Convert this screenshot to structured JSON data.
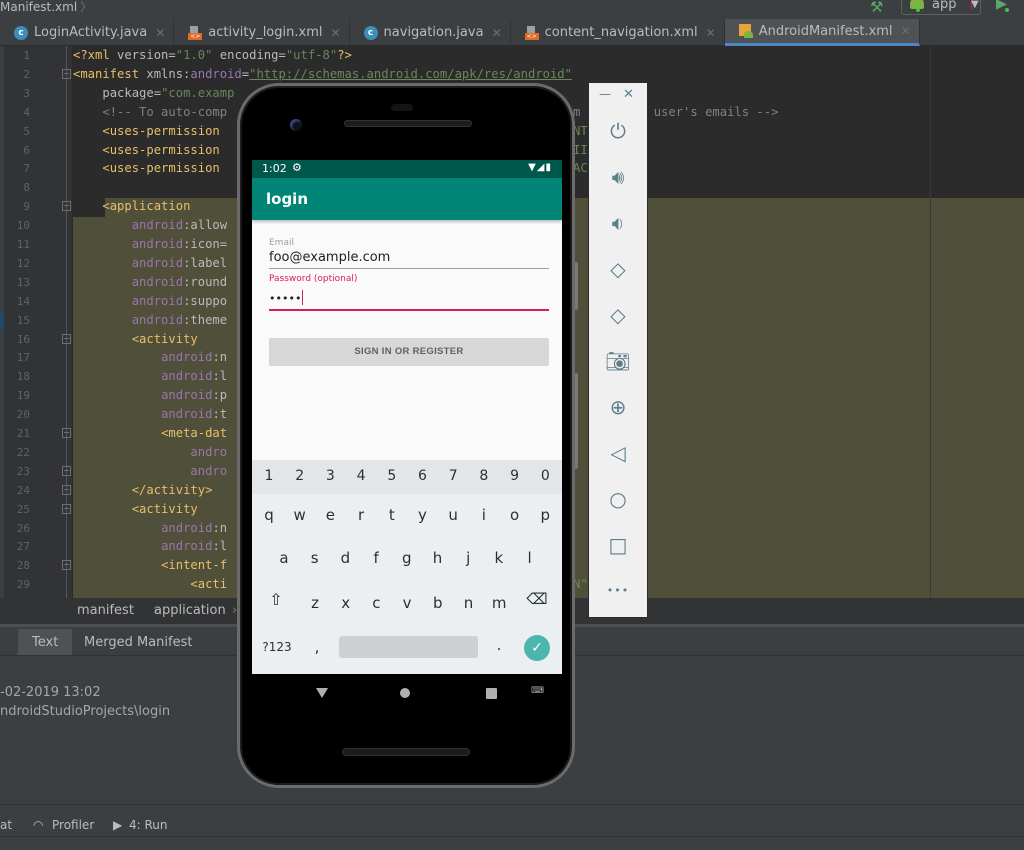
{
  "topbar": {
    "breadcrumb": "Manifest.xml",
    "config_label": "app",
    "build_icon": "hammer-icon",
    "run_icon": "run-icon"
  },
  "tabs": [
    {
      "label": "LoginActivity.java",
      "icon": "java-class-icon",
      "active": false
    },
    {
      "label": "activity_login.xml",
      "icon": "layout-xml-icon",
      "active": false
    },
    {
      "label": "navigation.java",
      "icon": "java-class-icon",
      "active": false
    },
    {
      "label": "content_navigation.xml",
      "icon": "layout-xml-icon",
      "active": false
    },
    {
      "label": "AndroidManifest.xml",
      "icon": "manifest-icon",
      "active": true
    }
  ],
  "editor": {
    "line_numbers": [
      "1",
      "2",
      "3",
      "4",
      "5",
      "6",
      "7",
      "8",
      "9",
      "10",
      "11",
      "12",
      "13",
      "14",
      "15",
      "16",
      "17",
      "18",
      "19",
      "20",
      "21",
      "22",
      "23",
      "24",
      "25",
      "26",
      "27",
      "28",
      "29"
    ],
    "lines": [
      {
        "indent": "",
        "parts": [
          [
            "tag",
            "<?xml "
          ],
          [
            "attr",
            "version="
          ],
          [
            "str",
            "\"1.0\" "
          ],
          [
            "attr",
            "encoding="
          ],
          [
            "str",
            "\"utf-8\""
          ],
          [
            "tag",
            "?>"
          ]
        ]
      },
      {
        "indent": "",
        "parts": [
          [
            "tag",
            "<manifest "
          ],
          [
            "attr",
            "xmlns:"
          ],
          [
            "ns",
            "android"
          ],
          [
            "attr",
            "="
          ],
          [
            "url",
            "\"http://schemas.android.com/apk/res/android\""
          ]
        ]
      },
      {
        "indent": "    ",
        "parts": [
          [
            "attr",
            "package="
          ],
          [
            "str",
            "\"com.examp"
          ]
        ]
      },
      {
        "indent": "    ",
        "parts": [
          [
            "com",
            "<!-- To auto-comp"
          ]
        ]
      },
      {
        "indent": "    ",
        "parts": [
          [
            "tag",
            "<uses-permission"
          ]
        ]
      },
      {
        "indent": "    ",
        "parts": [
          [
            "tag",
            "<uses-permission"
          ]
        ]
      },
      {
        "indent": "    ",
        "parts": [
          [
            "tag",
            "<uses-permission"
          ]
        ]
      },
      {
        "indent": "",
        "parts": []
      },
      {
        "indent": "    ",
        "parts": [
          [
            "tag",
            "<application"
          ]
        ]
      },
      {
        "indent": "        ",
        "parts": [
          [
            "ns",
            "android"
          ],
          [
            "attr",
            ":allow"
          ]
        ]
      },
      {
        "indent": "        ",
        "parts": [
          [
            "ns",
            "android"
          ],
          [
            "attr",
            ":icon="
          ]
        ]
      },
      {
        "indent": "        ",
        "parts": [
          [
            "ns",
            "android"
          ],
          [
            "attr",
            ":label"
          ]
        ]
      },
      {
        "indent": "        ",
        "parts": [
          [
            "ns",
            "android"
          ],
          [
            "attr",
            ":round"
          ]
        ]
      },
      {
        "indent": "        ",
        "parts": [
          [
            "ns",
            "android"
          ],
          [
            "attr",
            ":suppo"
          ]
        ]
      },
      {
        "indent": "        ",
        "parts": [
          [
            "ns",
            "android"
          ],
          [
            "attr",
            ":theme"
          ]
        ]
      },
      {
        "indent": "        ",
        "parts": [
          [
            "tag",
            "<activity"
          ]
        ]
      },
      {
        "indent": "            ",
        "parts": [
          [
            "ns",
            "android"
          ],
          [
            "attr",
            ":n"
          ]
        ]
      },
      {
        "indent": "            ",
        "parts": [
          [
            "ns",
            "android"
          ],
          [
            "attr",
            ":l"
          ]
        ]
      },
      {
        "indent": "            ",
        "parts": [
          [
            "ns",
            "android"
          ],
          [
            "attr",
            ":p"
          ]
        ]
      },
      {
        "indent": "            ",
        "parts": [
          [
            "ns",
            "android"
          ],
          [
            "attr",
            ":t"
          ]
        ]
      },
      {
        "indent": "            ",
        "parts": [
          [
            "tag",
            "<meta-dat"
          ]
        ]
      },
      {
        "indent": "                ",
        "parts": [
          [
            "ns",
            "andro"
          ]
        ]
      },
      {
        "indent": "                ",
        "parts": [
          [
            "ns",
            "andro"
          ]
        ]
      },
      {
        "indent": "        ",
        "parts": [
          [
            "tag",
            "</activity>"
          ]
        ]
      },
      {
        "indent": "        ",
        "parts": [
          [
            "tag",
            "<activity"
          ]
        ]
      },
      {
        "indent": "            ",
        "parts": [
          [
            "ns",
            "android"
          ],
          [
            "attr",
            ":n"
          ]
        ]
      },
      {
        "indent": "            ",
        "parts": [
          [
            "ns",
            "android"
          ],
          [
            "attr",
            ":l"
          ]
        ]
      },
      {
        "indent": "            ",
        "parts": [
          [
            "tag",
            "<intent-f"
          ]
        ]
      },
      {
        "indent": "                ",
        "parts": [
          [
            "tag",
            "<acti"
          ]
        ]
      }
    ],
    "right_fragments": [
      {
        "line": 4,
        "text": "m        e user's emails -->",
        "kind": "com"
      },
      {
        "line": 5,
        "text": "NT",
        "kind": "str"
      },
      {
        "line": 6,
        "text": "II",
        "kind": "str"
      },
      {
        "line": 7,
        "text": "AC",
        "kind": "str"
      },
      {
        "line": 29,
        "text": "N\"",
        "kind": "str"
      }
    ]
  },
  "editor_breadcrumbs": [
    "manifest",
    "application"
  ],
  "bottom_tabs": [
    {
      "label": "Text",
      "active": true
    },
    {
      "label": "Merged Manifest",
      "active": false
    }
  ],
  "log": {
    "lines": [
      "-02-2019 13:02",
      "ndroidStudioProjects\\login"
    ]
  },
  "toolstrip": {
    "items": [
      {
        "label": "at",
        "icon": ""
      },
      {
        "label": "Profiler",
        "icon": "gauge-icon"
      },
      {
        "label": "4: Run",
        "icon": "run-icon"
      }
    ]
  },
  "phone": {
    "status_time": "1:02",
    "app_title": "login",
    "email_label": "Email",
    "email_value": "foo@example.com",
    "password_label": "Password (optional)",
    "password_value": "•••••",
    "signin_button": "SIGN IN OR REGISTER",
    "colors": {
      "primary": "#008577",
      "primary_dark": "#00574b",
      "accent": "#d81b60"
    },
    "keyboard": {
      "numbers": [
        "1",
        "2",
        "3",
        "4",
        "5",
        "6",
        "7",
        "8",
        "9",
        "0"
      ],
      "row1": [
        "q",
        "w",
        "e",
        "r",
        "t",
        "y",
        "u",
        "i",
        "o",
        "p"
      ],
      "row2": [
        "a",
        "s",
        "d",
        "f",
        "g",
        "h",
        "j",
        "k",
        "l"
      ],
      "row3": [
        "z",
        "x",
        "c",
        "v",
        "b",
        "n",
        "m"
      ],
      "symbols_key": "?123",
      "comma_key": ",",
      "period_key": "."
    }
  },
  "emulator_toolbar": {
    "buttons": [
      {
        "name": "power",
        "icon": "power-icon"
      },
      {
        "name": "volume-up",
        "icon": "volume-up-icon"
      },
      {
        "name": "volume-down",
        "icon": "volume-down-icon"
      },
      {
        "name": "rotate-left",
        "icon": "rotate-left-icon"
      },
      {
        "name": "rotate-right",
        "icon": "rotate-right-icon"
      },
      {
        "name": "screenshot",
        "icon": "camera-icon"
      },
      {
        "name": "zoom",
        "icon": "zoom-in-icon"
      },
      {
        "name": "back",
        "icon": "back-icon"
      },
      {
        "name": "home",
        "icon": "home-icon"
      },
      {
        "name": "overview",
        "icon": "overview-icon"
      },
      {
        "name": "more",
        "icon": "more-icon"
      }
    ]
  }
}
